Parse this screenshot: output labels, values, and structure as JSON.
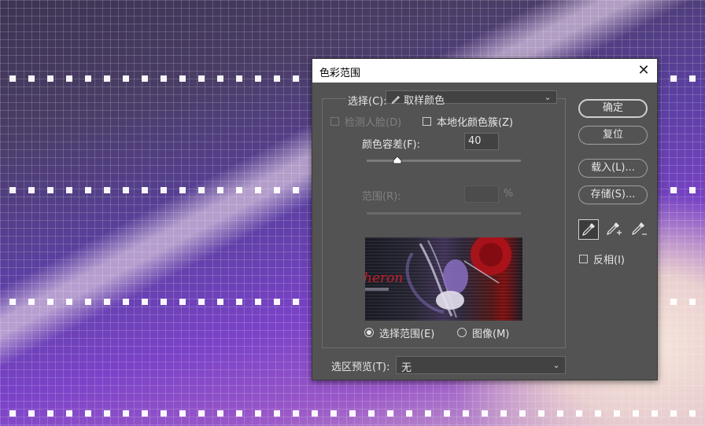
{
  "dialog": {
    "title": "色彩范围",
    "close": "✕",
    "select_label": "选择(C):",
    "select_value": "取样颜色",
    "detect_faces": "检测人脸(D)",
    "localized_clusters": "本地化颜色簇(Z)",
    "fuzziness_label": "颜色容差(F):",
    "fuzziness_value": "40",
    "fuzziness_level": 40,
    "range_label": "范围(R):",
    "range_unit": "%",
    "radio_selection": "选择范围(E)",
    "radio_image": "图像(M)",
    "preview_label": "选区预览(T):",
    "preview_value": "无",
    "preview_text": "heron",
    "invert": "反相(I)"
  },
  "buttons": {
    "ok": "确定",
    "reset": "复位",
    "load": "载入(L)...",
    "save": "存储(S)..."
  },
  "icons": {
    "eyedropper": "eyedropper-icon",
    "eyedropper_plus": "eyedropper-plus-icon",
    "eyedropper_minus": "eyedropper-minus-icon"
  }
}
